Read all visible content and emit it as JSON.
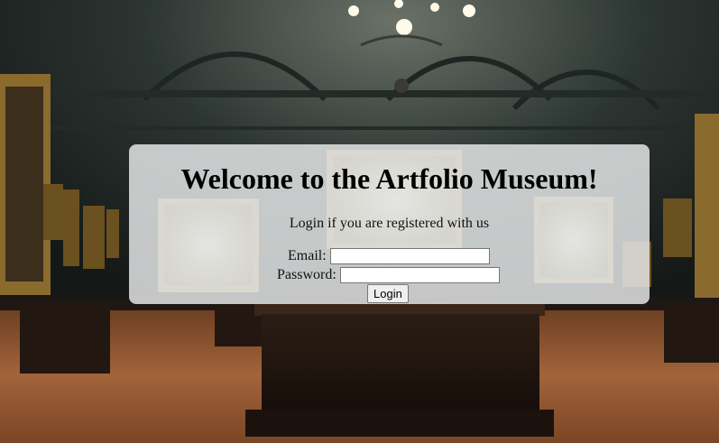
{
  "page": {
    "title": "Welcome to the Artfolio Museum!",
    "subtitle": "Login if you are registered with us"
  },
  "form": {
    "email_label": "Email:",
    "email_value": "",
    "password_label": "Password:",
    "password_value": "",
    "login_button": "Login"
  },
  "colors": {
    "panel": "#e6e8e8",
    "floor": "#8a5230",
    "wall": "#2a3330"
  },
  "background": {
    "icon": "museum-gallery-photo"
  }
}
